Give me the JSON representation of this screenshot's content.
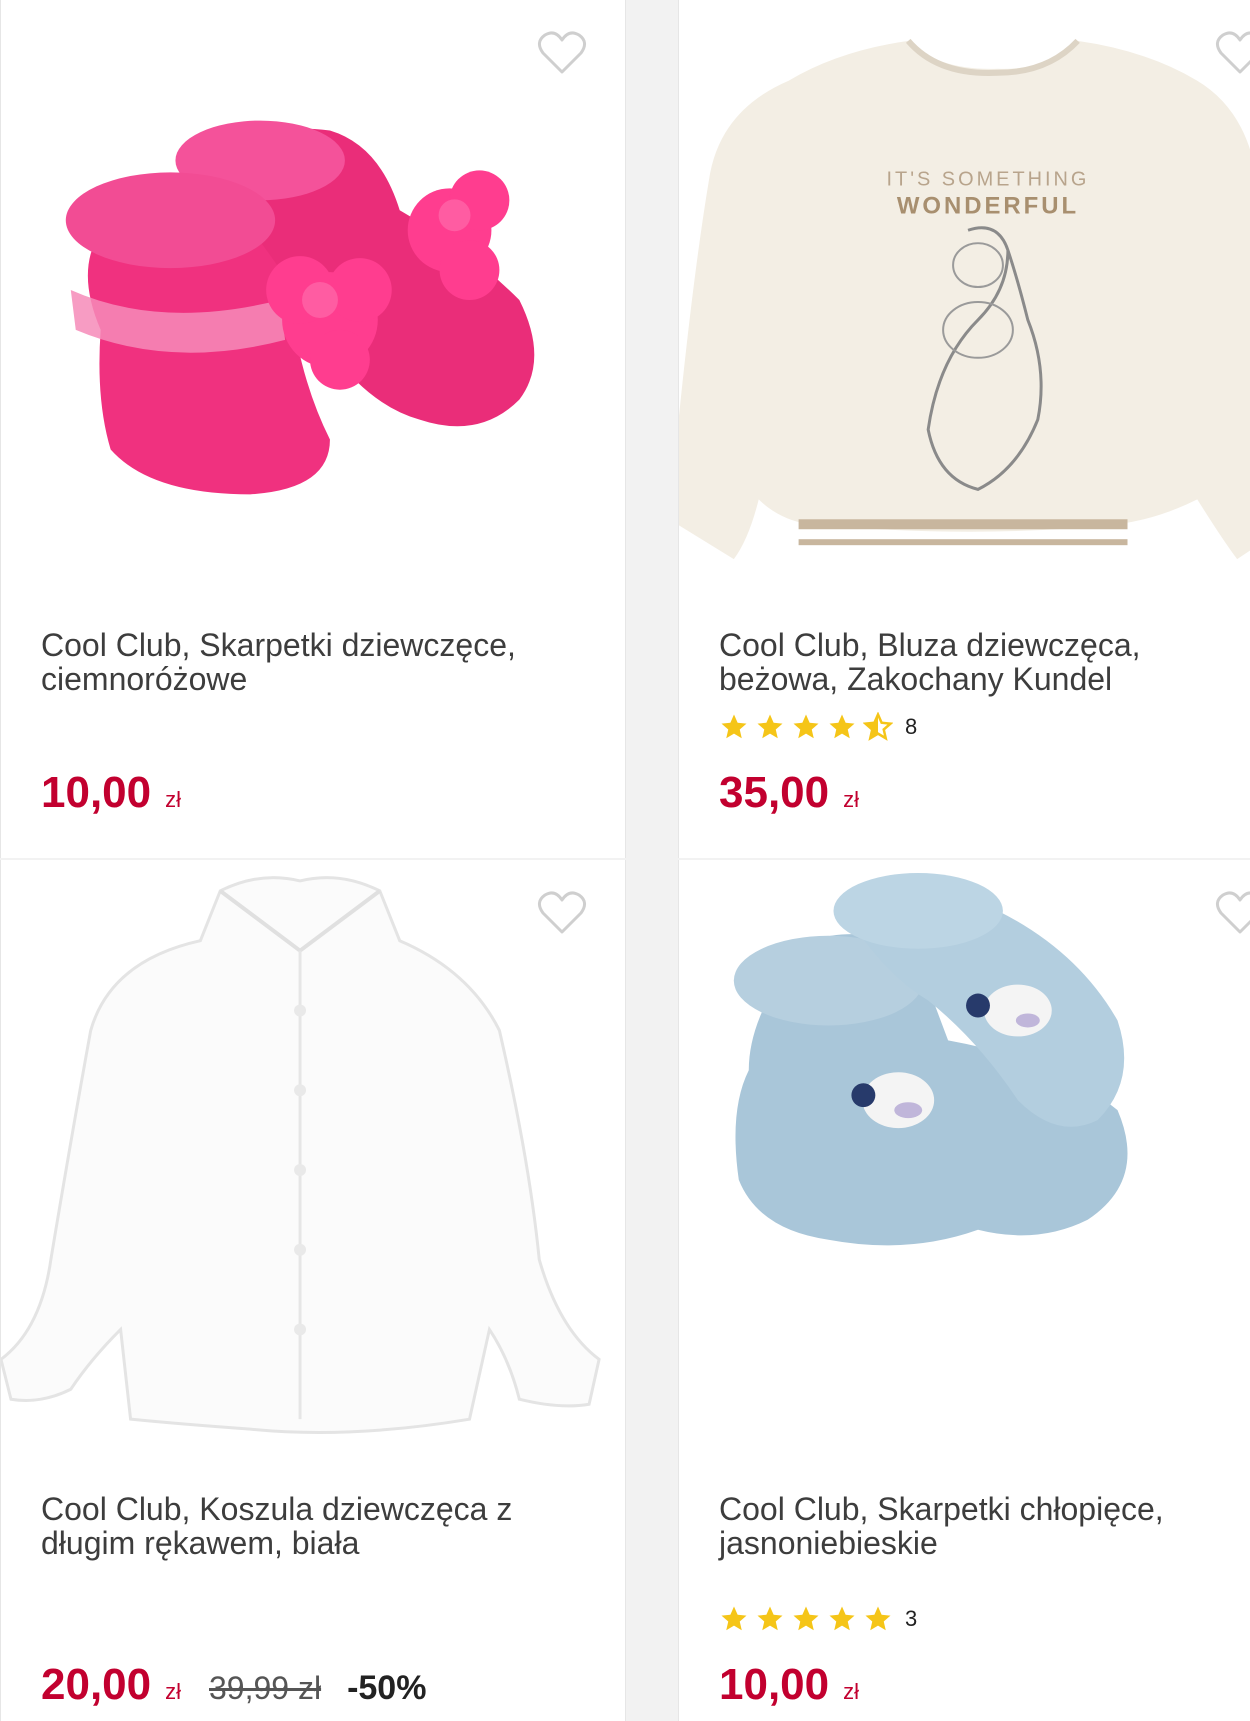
{
  "products": [
    {
      "title": "Cool Club, Skarpetki dziewczęce, ciemnoróżowe",
      "price": "10,00",
      "currency": "zł",
      "image": "pink-baby-socks-with-flowers",
      "favorite_icon": "heart-outline-icon"
    },
    {
      "title": "Cool Club, Bluza dziewczęca, beżowa, Zakochany Kundel",
      "price": "35,00",
      "currency": "zł",
      "rating_value": 4.5,
      "rating_count": "8",
      "image": "beige-sweatshirt-lady-and-tramp",
      "favorite_icon": "heart-outline-icon",
      "image_text_line1": "IT'S SOMETHING",
      "image_text_line2": "WONDERFUL"
    },
    {
      "title": "Cool Club, Koszula dziewczęca z długim rękawem, biała",
      "price": "20,00",
      "currency": "zł",
      "old_price": "39,99 zł",
      "discount": "-50%",
      "image": "white-long-sleeve-shirt",
      "favorite_icon": "heart-outline-icon"
    },
    {
      "title": "Cool Club, Skarpetki chłopięce, jasnoniebieskie",
      "price": "10,00",
      "currency": "zł",
      "rating_value": 5,
      "rating_count": "3",
      "image": "light-blue-baby-socks-with-sheep",
      "favorite_icon": "heart-outline-icon"
    }
  ],
  "colors": {
    "price": "#c2002f",
    "star": "#f5c518",
    "text": "#3d3d3d"
  }
}
